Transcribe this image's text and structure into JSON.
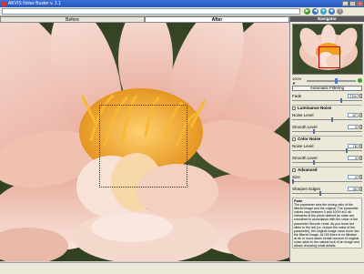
{
  "window": {
    "title": "AKVIS Noise Buster v. 1.1"
  },
  "tabs": [
    {
      "label": "Before",
      "active": false
    },
    {
      "label": "After",
      "active": true
    }
  ],
  "panel": {
    "header": "Navigator",
    "zoom_label": "100% ▼",
    "zoom_level": 0.6,
    "auto_button": "Automatic Filtering",
    "fade": {
      "label": "Fade",
      "value": "71%",
      "slider": 0.71
    },
    "luminance": {
      "title": "Luminance Noise",
      "noise_level": {
        "label": "Noise Level",
        "value": "57",
        "slider": 0.57
      },
      "smooth_level": {
        "label": "Smooth Level",
        "value": "3",
        "slider": 0.3
      }
    },
    "color": {
      "title": "Color Noise",
      "noise_level": {
        "label": "Noise Level",
        "value": "78",
        "slider": 0.78
      },
      "smooth_level": {
        "label": "Smooth Level",
        "value": "3",
        "slider": 0.3
      }
    },
    "advanced": {
      "title": "Advanced",
      "size": {
        "label": "Size",
        "value": "0",
        "slider": 0.0
      },
      "sharpen": {
        "label": "Sharpen Edges",
        "value": "40",
        "slider": 0.4
      }
    },
    "help": {
      "title": "Fade",
      "text": "The parameter sets the mixing ratio of the filtered image and the original. The parameter values vary between 0 and 100% at 0 all elements of the photo defined as noise are smoothed in accordance with the value of the parameter Smooth Level. As you move the slider to the left (i.e. reduce the value of the parameter), the original image noise more into the filtered image. At 100 there is no filtration at all. In most cases certain amount of original noise adds to the natural look of an image and allows removing small details."
    }
  },
  "colors": {
    "titlebar": "#2a56b8",
    "petal": "#f2c8b8",
    "center": "#f0a020",
    "background": "#3b4a2a"
  }
}
